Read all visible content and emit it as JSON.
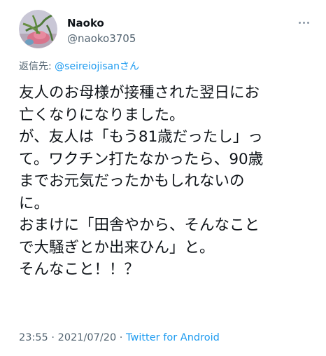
{
  "author": {
    "display_name": "Naoko",
    "handle": "@naoko3705"
  },
  "reply": {
    "label": "返信先:",
    "target": "@seireiojisanさん"
  },
  "tweet": {
    "lines": [
      "友人のお母様が接種された翌日にお",
      "亡くなりになりました。",
      "が、友人は「もう81歳だったし」っ",
      "て。ワクチン打たなかったら、90歳",
      "までお元気だったかもしれないの",
      "に。",
      "おまけに「田舎やから、そんなこと",
      "で大騒ぎとか出来ひん」と。",
      "そんなこと！！？"
    ]
  },
  "meta": {
    "time": "23:55",
    "separator": " · ",
    "date": "2021/07/20",
    "source": "Twitter for Android"
  },
  "icons": {
    "more": "more-options-icon",
    "avatar": "avatar-image"
  }
}
